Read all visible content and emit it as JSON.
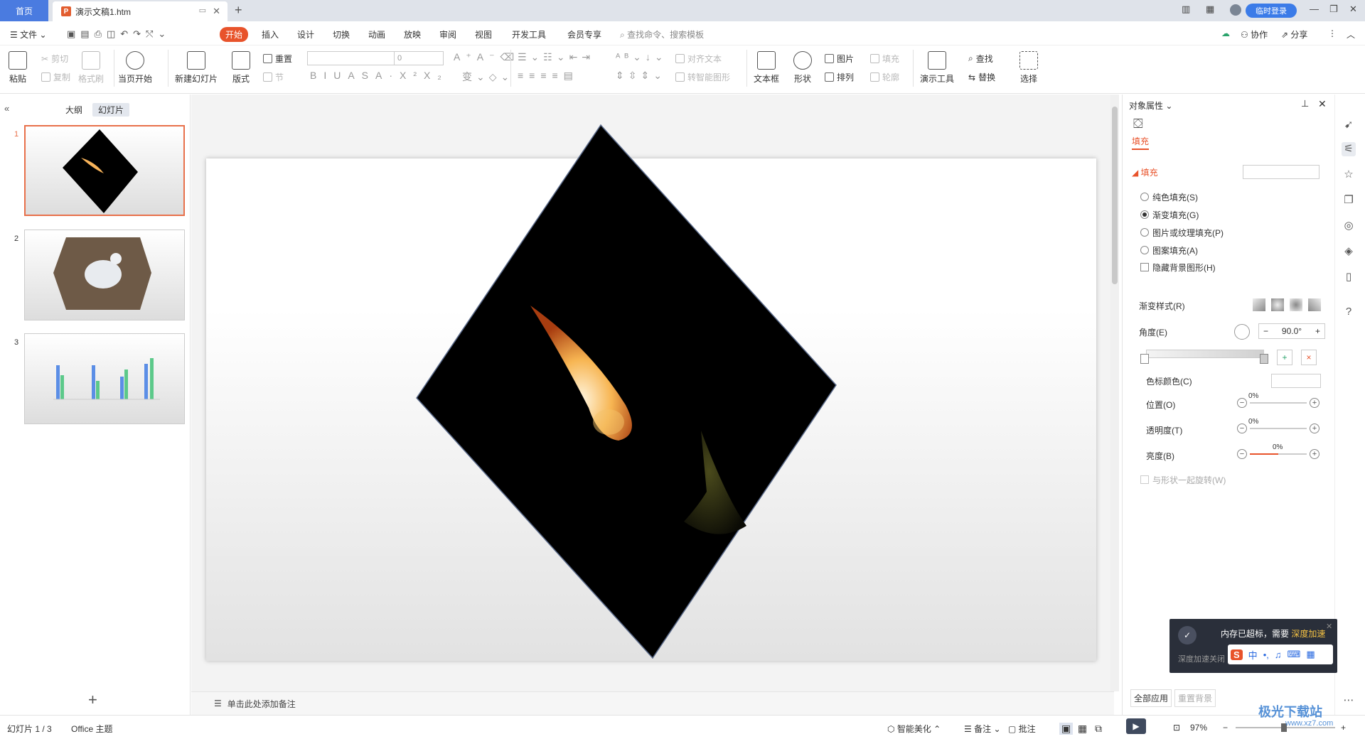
{
  "titlebar": {
    "home_tab": "首页",
    "doc_tab": "演示文稿1.htm",
    "doc_icon": "P",
    "login": "临时登录"
  },
  "menu": {
    "file": "文件",
    "items": [
      "开始",
      "插入",
      "设计",
      "切换",
      "动画",
      "放映",
      "审阅",
      "视图",
      "开发工具",
      "会员专享"
    ],
    "search": "查找命令、搜索模板",
    "cooperate": "协作",
    "share": "分享"
  },
  "ribbon": {
    "paste": "粘贴",
    "cut": "剪切",
    "copy": "复制",
    "format_painter": "格式刷",
    "play_current": "当页开始",
    "new_slide": "新建幻灯片",
    "layout": "版式",
    "reset": "重置",
    "section": "节",
    "font_size": "0",
    "align_text": "对齐文本",
    "smart_shape": "转智能图形",
    "textbox": "文本框",
    "shape": "形状",
    "picture": "图片",
    "fill": "填充",
    "arrange": "排列",
    "outline": "轮廓",
    "presenter_tools": "演示工具",
    "find": "查找",
    "replace": "替换",
    "select": "选择"
  },
  "left_panel": {
    "tab_outline": "大纲",
    "tab_slides": "幻灯片",
    "slides": [
      {
        "num": "1"
      },
      {
        "num": "2"
      },
      {
        "num": "3"
      }
    ]
  },
  "notes": {
    "placeholder": "单击此处添加备注"
  },
  "right_panel": {
    "title": "对象属性",
    "fill_tab": "填充",
    "fill_section": "填充",
    "options": [
      "纯色填充(S)",
      "渐变填充(G)",
      "图片或纹理填充(P)",
      "图案填充(A)"
    ],
    "selected_option": "渐变填充(G)",
    "hide_bg": "隐藏背景图形(H)",
    "gradient_style": "渐变样式(R)",
    "angle_label": "角度(E)",
    "angle_value": "90.0°",
    "stop_color": "色标颜色(C)",
    "position": "位置(O)",
    "position_value": "0%",
    "transparency": "透明度(T)",
    "transparency_value": "0%",
    "brightness": "亮度(B)",
    "brightness_value": "0%",
    "rotate_with_shape": "与形状一起旋转(W)",
    "apply_all": "全部应用",
    "reset_bg": "重置背景"
  },
  "status": {
    "slide_pos": "幻灯片 1 / 3",
    "theme": "Office 主题",
    "smart_beautify": "智能美化",
    "notes": "备注",
    "comments": "批注",
    "zoom": "97%"
  },
  "popup": {
    "message": "内存已超标，需要",
    "link": "深度加速",
    "sub": "深度加速关闭"
  },
  "watermark": "极光下载站",
  "watermark_url": "www.xz7.com",
  "colors": {
    "accent": "#e8532b",
    "blue": "#3b7be8"
  }
}
